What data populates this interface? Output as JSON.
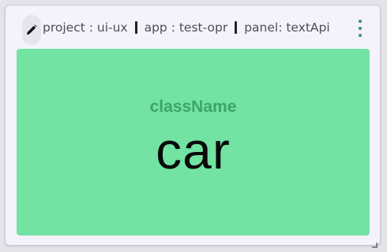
{
  "panel": {
    "edit_icon": "pencil-icon",
    "title_segments": [
      "project : ui-ux",
      "app : test-opr",
      "panel: textApi"
    ],
    "menu_icon": "more-vertical-icon",
    "resize_icon": "resize-corner-icon"
  },
  "content": {
    "label": "className",
    "value": "car",
    "background_color": "#72e3a2",
    "label_color": "#3fa36a"
  }
}
